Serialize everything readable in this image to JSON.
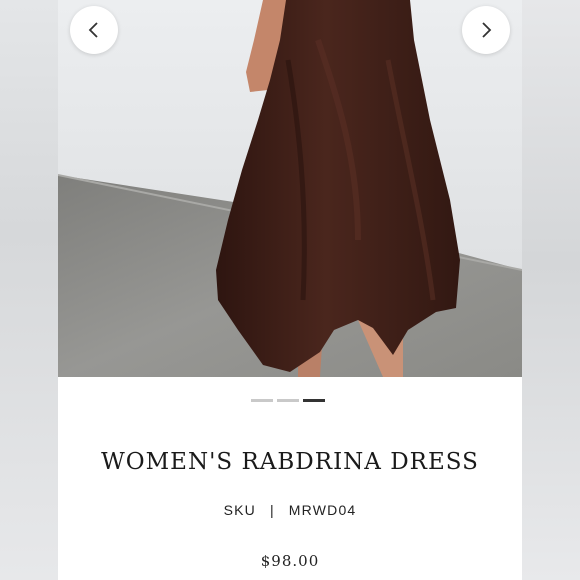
{
  "product": {
    "title": "WOMEN'S RABDRINA DRESS",
    "sku_label": "SKU",
    "sku_separator": "|",
    "sku_value": "MRWD04",
    "price": "$98.00"
  },
  "carousel": {
    "total_slides": 3,
    "active_slide": 3,
    "prev_icon": "chevron-left-icon",
    "next_icon": "chevron-right-icon"
  },
  "colors": {
    "dress": "#3b1d16",
    "wall": "#e9eaec",
    "floor": "#8a8a87",
    "dot_active": "#333333",
    "dot_inactive": "#c9c9c9"
  }
}
